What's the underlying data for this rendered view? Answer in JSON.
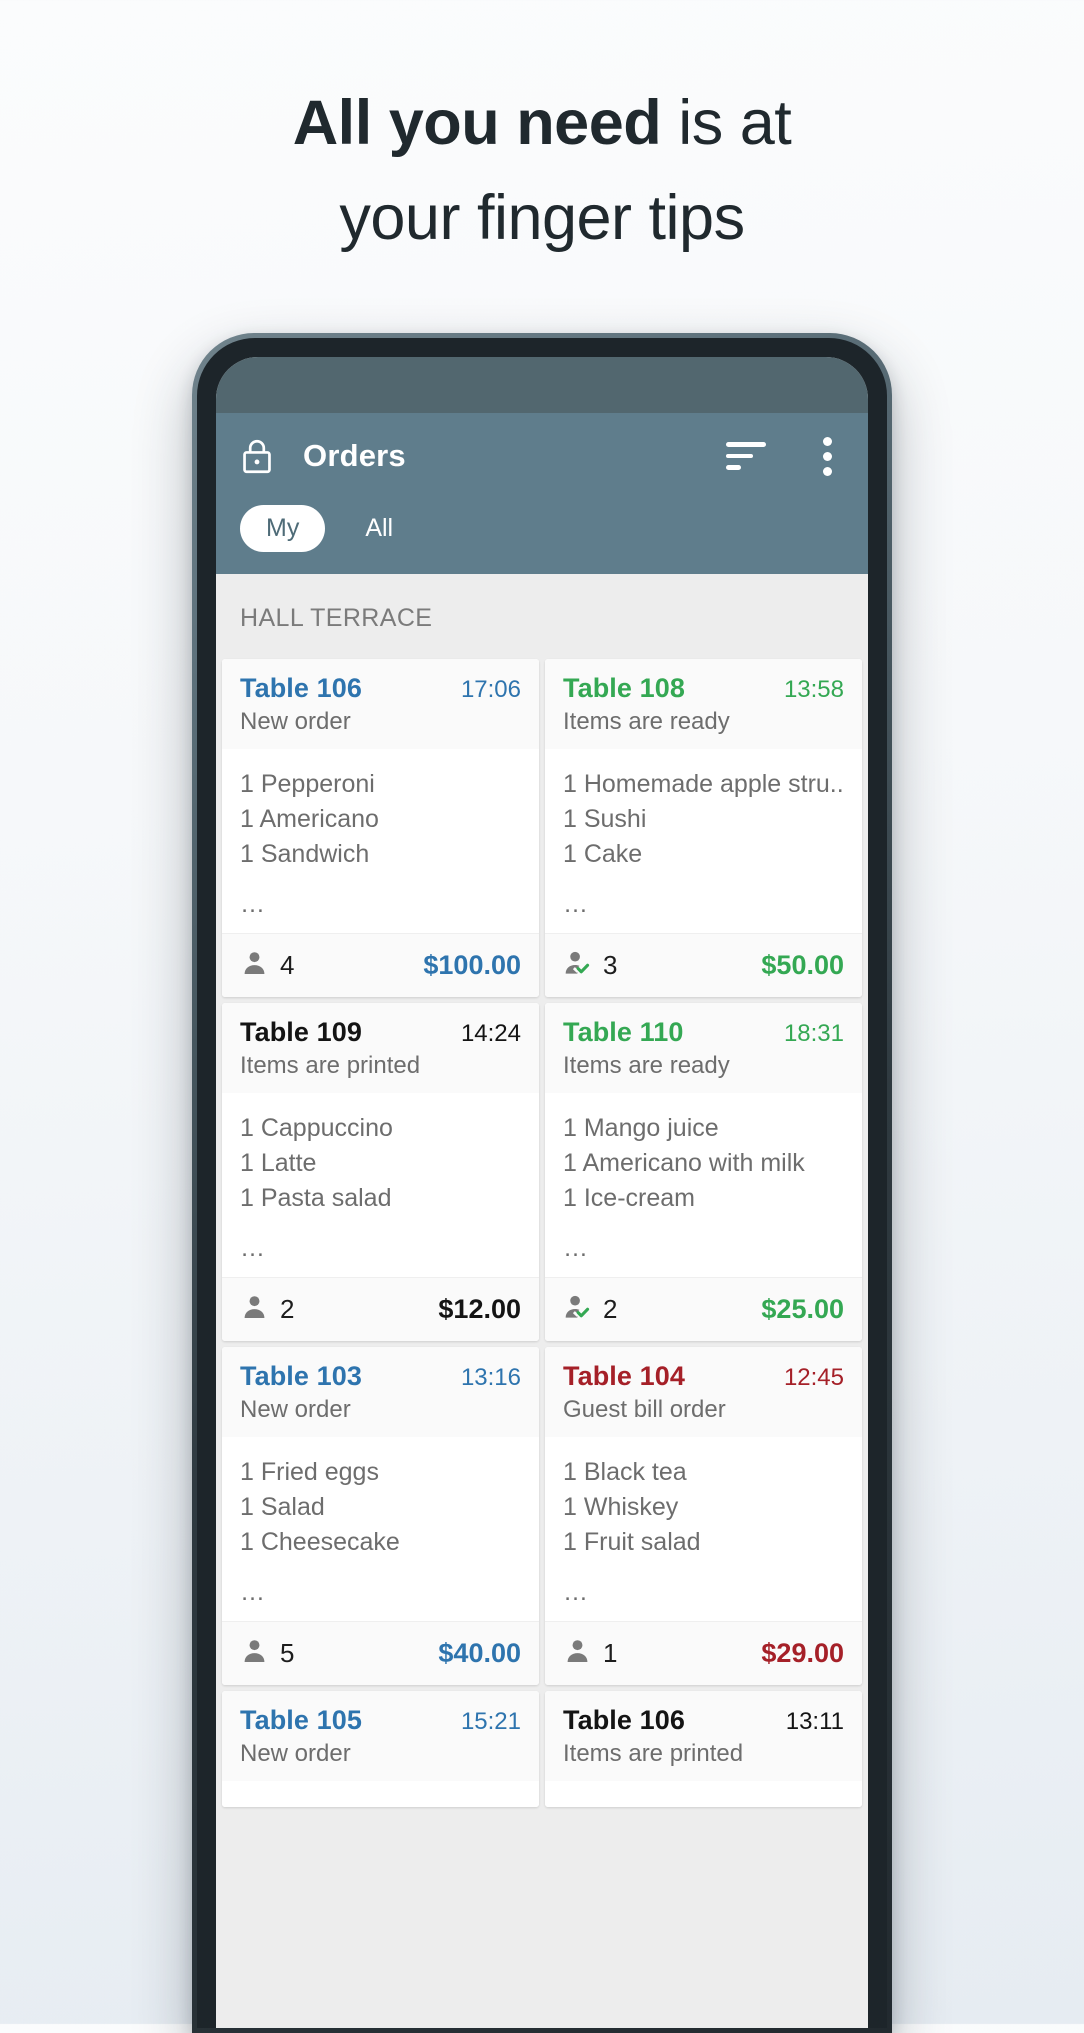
{
  "headline": {
    "bold": "All you need",
    "rest": " is at",
    "line2": "your finger tips"
  },
  "app": {
    "title": "Orders",
    "lock_icon": "lock-icon",
    "sort_icon": "sort-icon",
    "overflow_icon": "more-vertical-icon",
    "tabs": [
      {
        "label": "My",
        "active": true
      },
      {
        "label": "All",
        "active": false
      }
    ],
    "section_header": "HALL TERRACE"
  },
  "colors": {
    "appbar": "#5f7d8c",
    "status_bar": "#52676f",
    "blue": "#2e74ae",
    "green": "#34a853",
    "red": "#a52028",
    "black": "#141414",
    "muted": "#6d6d6d",
    "content_bg": "#ededed"
  },
  "orders": [
    {
      "table": "Table 106",
      "time": "17:06",
      "status": "New order",
      "color": "blue",
      "items": [
        "1 Pepperoni",
        "1 Americano",
        "1 Sandwich"
      ],
      "more": "…",
      "guests": "4",
      "guests_icon": "person-icon",
      "total": "$100.00"
    },
    {
      "table": "Table 108",
      "time": "13:58",
      "status": "Items are ready",
      "color": "green",
      "items": [
        "1 Homemade apple stru...",
        "1 Sushi",
        "1 Cake"
      ],
      "more": "…",
      "guests": "3",
      "guests_icon": "person-check-icon",
      "total": "$50.00"
    },
    {
      "table": "Table 109",
      "time": "14:24",
      "status": "Items are printed",
      "color": "black",
      "items": [
        "1 Cappuccino",
        "1 Latte",
        "1 Pasta salad"
      ],
      "more": "…",
      "guests": "2",
      "guests_icon": "person-icon",
      "total": "$12.00"
    },
    {
      "table": "Table 110",
      "time": "18:31",
      "status": "Items are ready",
      "color": "green",
      "items": [
        "1 Mango juice",
        "1 Americano with milk",
        "1 Ice-cream"
      ],
      "more": "…",
      "guests": "2",
      "guests_icon": "person-check-icon",
      "total": "$25.00"
    },
    {
      "table": "Table 103",
      "time": "13:16",
      "status": "New order",
      "color": "blue",
      "items": [
        "1 Fried eggs",
        "1 Salad",
        "1 Cheesecake"
      ],
      "more": "…",
      "guests": "5",
      "guests_icon": "person-icon",
      "total": "$40.00"
    },
    {
      "table": "Table 104",
      "time": "12:45",
      "status": "Guest bill order",
      "color": "red",
      "items": [
        "1 Black tea",
        "1 Whiskey",
        "1 Fruit salad"
      ],
      "more": "…",
      "guests": "1",
      "guests_icon": "person-icon",
      "total": "$29.00"
    },
    {
      "table": "Table 105",
      "time": "15:21",
      "status": "New order",
      "color": "blue",
      "items": [],
      "more": "",
      "guests": "",
      "guests_icon": "person-icon",
      "total": ""
    },
    {
      "table": "Table 106",
      "time": "13:11",
      "status": "Items are printed",
      "color": "black",
      "items": [],
      "more": "",
      "guests": "",
      "guests_icon": "person-icon",
      "total": ""
    }
  ]
}
